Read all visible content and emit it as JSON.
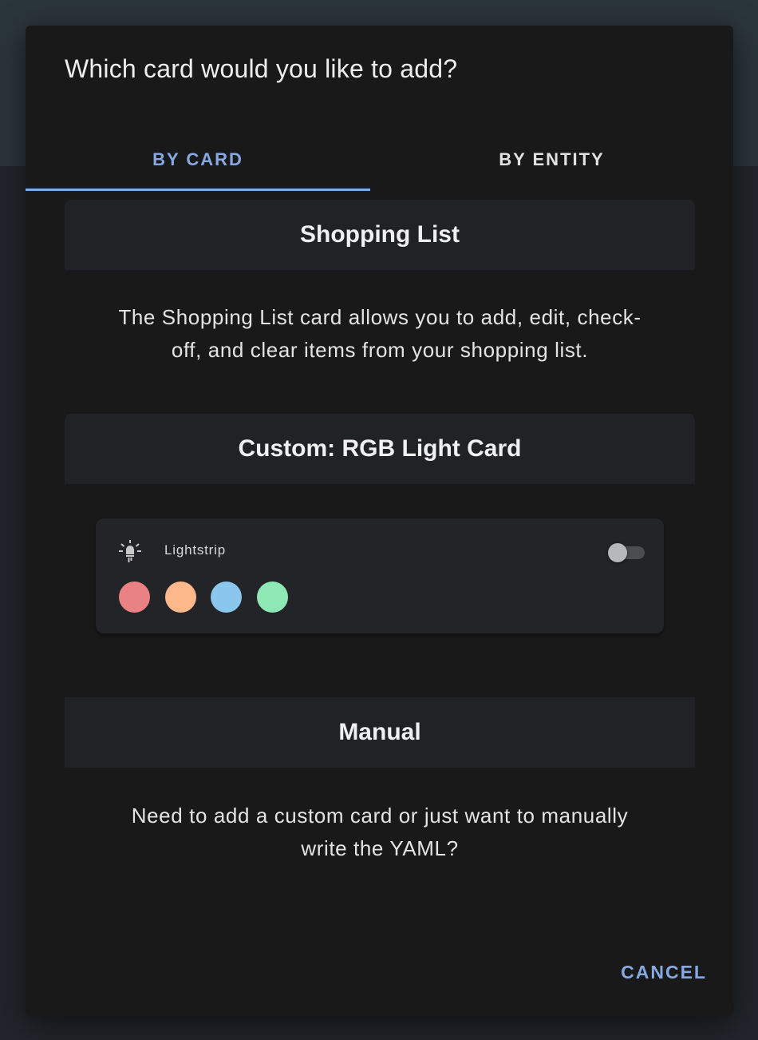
{
  "dialog": {
    "title": "Which card would you like to add?",
    "tabs": [
      {
        "label": "BY CARD",
        "active": true
      },
      {
        "label": "BY ENTITY",
        "active": false
      }
    ],
    "cards": [
      {
        "title": "Shopping List",
        "description_line1": "The Shopping List card allows you to add, edit, check-",
        "description_line2": "off, and clear items from your shopping list."
      },
      {
        "title": "Custom: RGB Light Card",
        "preview": {
          "entity_icon": "lightbulb-icon",
          "entity_name": "Lightstrip",
          "toggle_state": "off",
          "colors": [
            "#e98284",
            "#fcb78a",
            "#8ac6ee",
            "#8ee8b4"
          ]
        }
      },
      {
        "title": "Manual",
        "description_line1": "Need to add a custom card or just want to manually",
        "description_line2": "write the YAML?"
      }
    ],
    "cancel_label": "CANCEL"
  },
  "colors": {
    "accent": "#86a9e1",
    "dialog_bg": "#19191a",
    "card_header_bg": "#202226"
  }
}
